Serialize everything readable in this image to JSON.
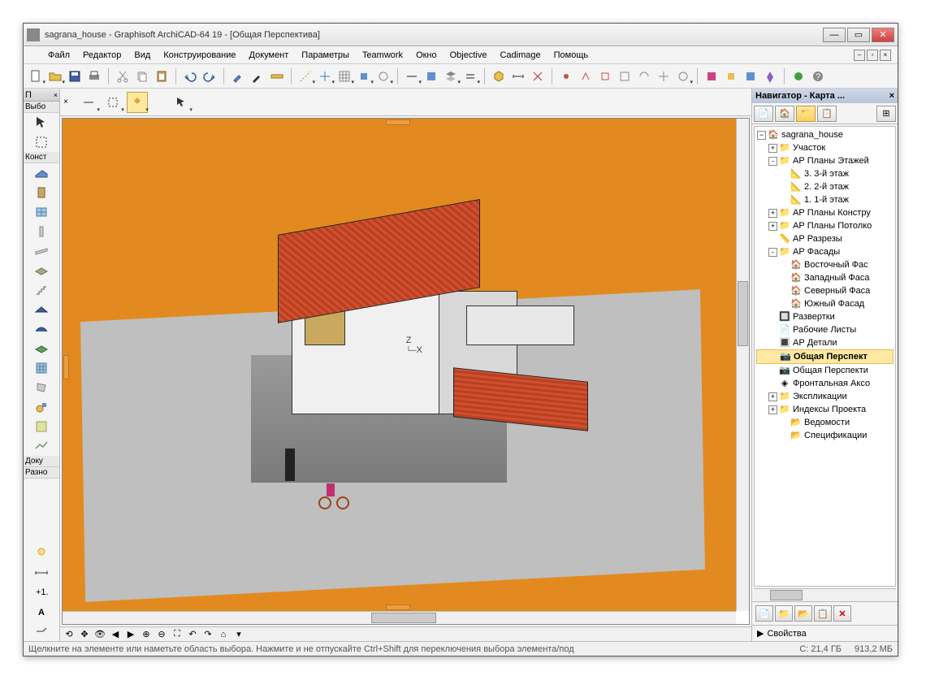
{
  "title": "sagrana_house - Graphisoft ArchiCAD-64 19 - [Общая Перспектива]",
  "menu": [
    "Файл",
    "Редактор",
    "Вид",
    "Конструирование",
    "Документ",
    "Параметры",
    "Teamwork",
    "Окно",
    "Objective",
    "Cadimage",
    "Помощь"
  ],
  "toolbox": {
    "header_letter": "П",
    "section1": "Выбо",
    "section2": "Конст",
    "section3": "Доку",
    "section4": "Разно"
  },
  "navigator": {
    "title": "Навигатор - Карта ...",
    "props": "Свойства",
    "tree": {
      "root": "sagrana_house",
      "items": [
        {
          "lvl": 1,
          "toggle": "+",
          "icon": "folder",
          "label": "Участок"
        },
        {
          "lvl": 1,
          "toggle": "-",
          "icon": "folder",
          "label": "АР Планы Этажей"
        },
        {
          "lvl": 2,
          "toggle": "",
          "icon": "plan",
          "label": "3. 3-й этаж"
        },
        {
          "lvl": 2,
          "toggle": "",
          "icon": "plan",
          "label": "2. 2-й этаж"
        },
        {
          "lvl": 2,
          "toggle": "",
          "icon": "plan",
          "label": "1. 1-й этаж"
        },
        {
          "lvl": 1,
          "toggle": "+",
          "icon": "folder",
          "label": "АР Планы Констру"
        },
        {
          "lvl": 1,
          "toggle": "+",
          "icon": "folder",
          "label": "АР Планы Потолко"
        },
        {
          "lvl": 1,
          "toggle": "",
          "icon": "section",
          "label": "АР Разрезы"
        },
        {
          "lvl": 1,
          "toggle": "-",
          "icon": "folder",
          "label": "АР Фасады"
        },
        {
          "lvl": 2,
          "toggle": "",
          "icon": "elev",
          "label": "Восточный Фас"
        },
        {
          "lvl": 2,
          "toggle": "",
          "icon": "elev",
          "label": "Западный Фаса"
        },
        {
          "lvl": 2,
          "toggle": "",
          "icon": "elev",
          "label": "Северный Фаса"
        },
        {
          "lvl": 2,
          "toggle": "",
          "icon": "elev",
          "label": "Южный Фасад"
        },
        {
          "lvl": 1,
          "toggle": "",
          "icon": "detail",
          "label": "Развертки"
        },
        {
          "lvl": 1,
          "toggle": "",
          "icon": "sheet",
          "label": "Рабочие Листы"
        },
        {
          "lvl": 1,
          "toggle": "",
          "icon": "detail2",
          "label": "АР Детали"
        },
        {
          "lvl": 1,
          "toggle": "",
          "icon": "cam",
          "label": "Общая Перспект",
          "sel": true,
          "bold": true
        },
        {
          "lvl": 1,
          "toggle": "",
          "icon": "cam",
          "label": "Общая Перспекти"
        },
        {
          "lvl": 1,
          "toggle": "",
          "icon": "axo",
          "label": "Фронтальная Аксо"
        },
        {
          "lvl": 1,
          "toggle": "+",
          "icon": "folder",
          "label": "Экспликации"
        },
        {
          "lvl": 1,
          "toggle": "+",
          "icon": "folder",
          "label": "Индексы Проекта"
        },
        {
          "lvl": 2,
          "toggle": "",
          "icon": "folder2",
          "label": "Ведомости"
        },
        {
          "lvl": 2,
          "toggle": "",
          "icon": "folder2",
          "label": "Спецификации"
        }
      ]
    }
  },
  "statusbar": {
    "hint": "Щелкните на элементе или наметьте область выбора. Нажмите и не отпускайте Ctrl+Shift для переключения выбора элемента/под",
    "disk": "C: 21,4 ГБ",
    "mem": "913,2 МБ"
  },
  "axis": {
    "x": "X",
    "z": "Z"
  }
}
